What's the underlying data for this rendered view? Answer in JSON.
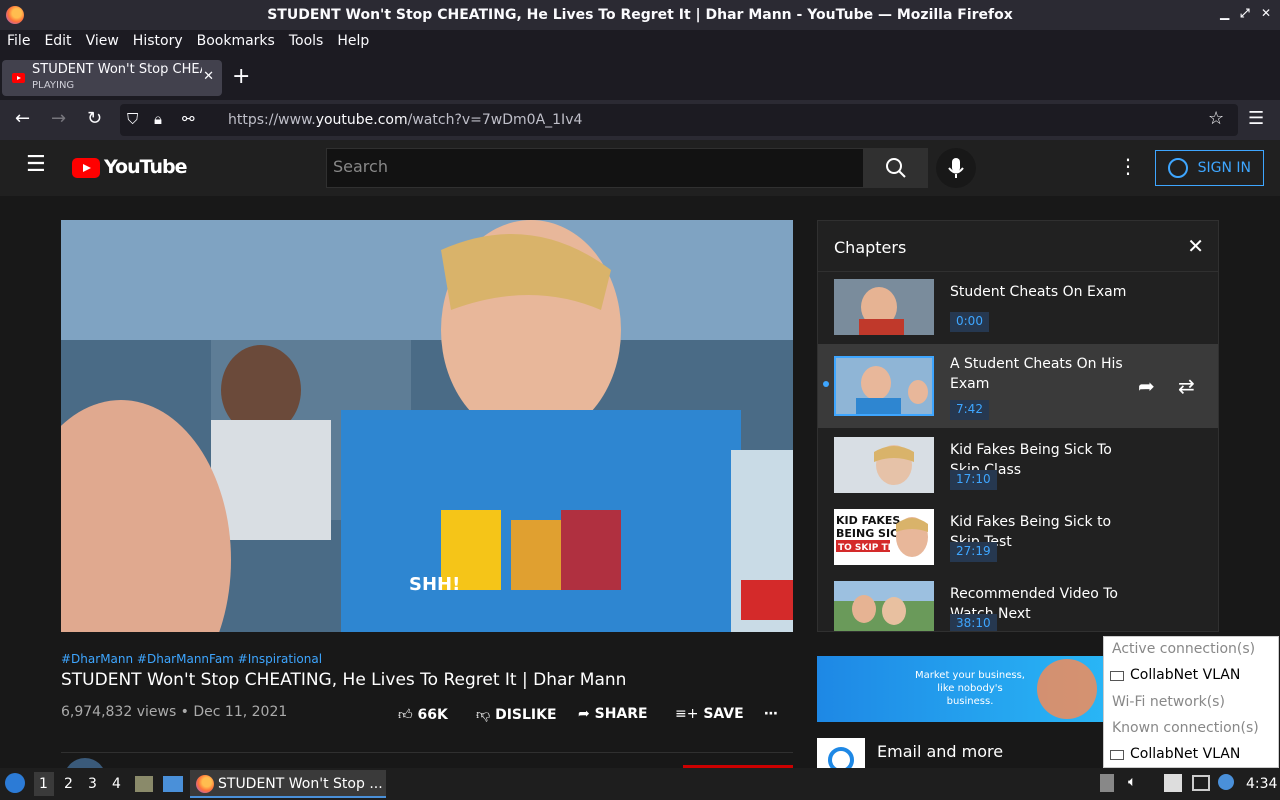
{
  "window": {
    "title": "STUDENT Won't Stop CHEATING, He Lives To Regret It | Dhar Mann - YouTube — Mozilla Firefox"
  },
  "menubar": [
    "File",
    "Edit",
    "View",
    "History",
    "Bookmarks",
    "Tools",
    "Help"
  ],
  "tab": {
    "title": "STUDENT Won't Stop CHEATING, He Lives To Regret It | Dhar Mann",
    "status": "PLAYING"
  },
  "address_bar": {
    "url_prefix": "https://www.",
    "url_domain": "youtube.com",
    "url_path": "/watch?v=7wDm0A_1Iv4"
  },
  "youtube": {
    "logo_text": "YouTube",
    "search_placeholder": "Search",
    "signin_label": "SIGN IN"
  },
  "video": {
    "caption_in_frame": "SHH!",
    "tags": "#DharMann #DharMannFam #Inspirational",
    "title": "STUDENT Won't Stop CHEATING, He Lives To Regret It | Dhar Mann",
    "views_date": "6,974,832 views • Dec 11, 2021",
    "likes": "66K",
    "dislike": "DISLIKE",
    "share": "SHARE",
    "save": "SAVE"
  },
  "chapters": {
    "heading": "Chapters",
    "items": [
      {
        "title": "Student Cheats On Exam",
        "time": "0:00"
      },
      {
        "title": "A Student Cheats On His Exam",
        "time": "7:42"
      },
      {
        "title": "Kid Fakes Being Sick To Skip Class",
        "time": "17:10"
      },
      {
        "title": "Kid Fakes Being Sick to Skip Test",
        "time": "27:19"
      },
      {
        "title": "Recommended Video To Watch Next",
        "time": "38:10"
      }
    ]
  },
  "ad": {
    "text": "Market your business, like nobody's business.",
    "email": "Email and more"
  },
  "network_popup": {
    "active_header": "Active connection(s)",
    "active_item": "CollabNet VLAN",
    "wifi_header": "Wi-Fi network(s)",
    "known_header": "Known connection(s)",
    "known_item": "CollabNet VLAN"
  },
  "taskbar": {
    "workspaces": [
      "1",
      "2",
      "3",
      "4"
    ],
    "window_title": "STUDENT Won't Stop ...",
    "clock": "4:34"
  },
  "colors": {
    "youtube_red": "#ff0000",
    "link_blue": "#3ea6ff",
    "chip_bg": "#263850"
  }
}
